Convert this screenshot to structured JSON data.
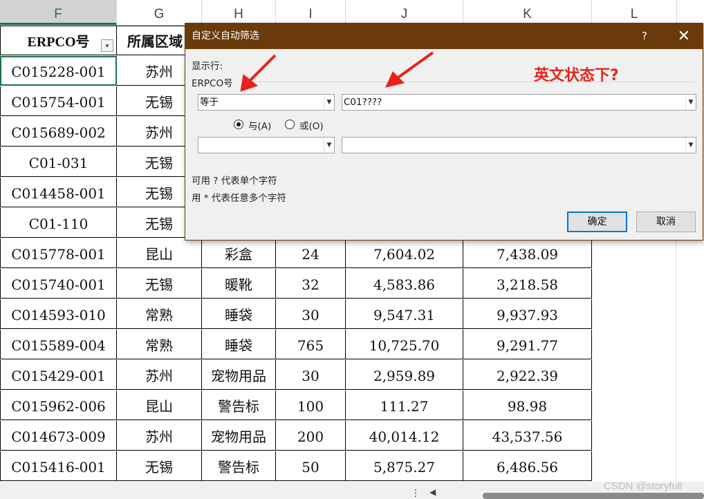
{
  "columns": [
    "F",
    "G",
    "H",
    "I",
    "J",
    "K",
    "L"
  ],
  "selected_column": "F",
  "table": {
    "headers": [
      "ERPCO号",
      "所属区域"
    ],
    "rows": [
      [
        "C015228-001",
        "苏州",
        "",
        "",
        "",
        ""
      ],
      [
        "C015754-001",
        "无锡",
        "",
        "",
        "",
        ""
      ],
      [
        "C015689-002",
        "苏州",
        "",
        "",
        "",
        ""
      ],
      [
        "C01-031",
        "无锡",
        "",
        "",
        "",
        ""
      ],
      [
        "C014458-001",
        "无锡",
        "",
        "",
        "",
        ""
      ],
      [
        "C01-110",
        "无锡",
        "",
        "",
        "",
        ""
      ],
      [
        "C015778-001",
        "昆山",
        "彩盒",
        "24",
        "7,604.02",
        "7,438.09"
      ],
      [
        "C015740-001",
        "无锡",
        "暖靴",
        "32",
        "4,583.86",
        "3,218.58"
      ],
      [
        "C014593-010",
        "常熟",
        "睡袋",
        "30",
        "9,547.31",
        "9,937.93"
      ],
      [
        "C015589-004",
        "常熟",
        "睡袋",
        "765",
        "10,725.70",
        "9,291.77"
      ],
      [
        "C015429-001",
        "苏州",
        "宠物用品",
        "30",
        "2,959.89",
        "2,922.39"
      ],
      [
        "C015962-006",
        "昆山",
        "警告标",
        "100",
        "111.27",
        "98.98"
      ],
      [
        "C014673-009",
        "苏州",
        "宠物用品",
        "200",
        "40,014.12",
        "43,537.56"
      ],
      [
        "C015416-001",
        "无锡",
        "警告标",
        "50",
        "5,875.27",
        "6,486.56"
      ]
    ]
  },
  "dialog": {
    "title": "自定义自动筛选",
    "help": "?",
    "close": "✕",
    "show_rows_label": "显示行:",
    "field_label": "ERPCO号",
    "op1": "等于",
    "value1": "C01????",
    "and_label": "与(A)",
    "or_label": "或(O)",
    "and_selected": true,
    "op2": "",
    "value2": "",
    "hint1": "可用 ? 代表单个字符",
    "hint2": "用 * 代表任意多个字符",
    "ok": "确定",
    "cancel": "取消"
  },
  "annotation": "英文状态下?",
  "watermark": "CSDN @storyfull",
  "colors": {
    "title_bar": "#6b3a0b",
    "annotation": "#e8231b",
    "selected_col": "#1e7145"
  }
}
